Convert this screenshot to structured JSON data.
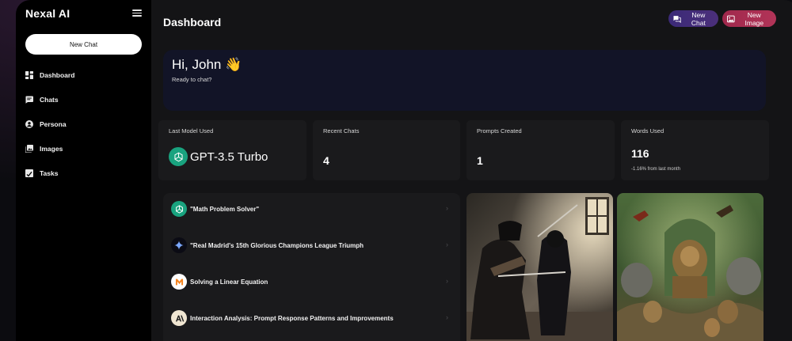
{
  "sidebar": {
    "brand": "Nexal AI",
    "new_chat_label": "New Chat",
    "items": [
      {
        "label": "Dashboard",
        "icon": "dashboard-icon"
      },
      {
        "label": "Chats",
        "icon": "chat-icon"
      },
      {
        "label": "Persona",
        "icon": "persona-icon"
      },
      {
        "label": "Images",
        "icon": "images-icon"
      },
      {
        "label": "Tasks",
        "icon": "tasks-icon"
      }
    ]
  },
  "header": {
    "title": "Dashboard",
    "new_chat_label": "New Chat",
    "new_image_label": "New Image"
  },
  "greeting": {
    "title": "Hi, John 👋",
    "subtitle": "Ready to chat?"
  },
  "stats": [
    {
      "title": "Last Model Used",
      "value": "GPT-3.5 Turbo"
    },
    {
      "title": "Recent Chats",
      "value": "4"
    },
    {
      "title": "Prompts Created",
      "value": "1"
    },
    {
      "title": "Words Used",
      "value": "116",
      "sub": "-1.16% from last month"
    }
  ],
  "recent_chats": [
    {
      "title": "\"Math Problem Solver\"",
      "icon": "openai-icon"
    },
    {
      "title": "\"Real Madrid's 15th Glorious Champions League Triumph",
      "icon": "gemini-icon"
    },
    {
      "title": "Solving a Linear Equation",
      "icon": "mistral-icon"
    },
    {
      "title": "Interaction Analysis: Prompt Response Patterns and Improvements",
      "icon": "anthropic-icon"
    }
  ],
  "colors": {
    "accent_chat": "#3b2a78",
    "accent_image": "#a0284c",
    "openai_green": "#19a37f",
    "card_bg": "#1a1a1c",
    "greeting_bg": "#121427"
  }
}
